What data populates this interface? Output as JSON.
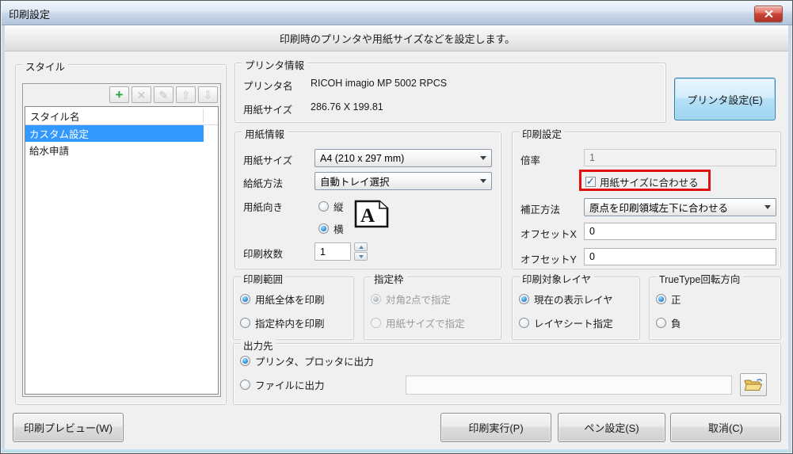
{
  "window": {
    "title": "印刷設定"
  },
  "header": {
    "subtitle": "印刷時のプリンタや用紙サイズなどを設定します。"
  },
  "style_panel": {
    "group_label": "スタイル",
    "list_header": "スタイル名",
    "items": [
      {
        "label": "カスタム設定"
      },
      {
        "label": "給水申請"
      }
    ]
  },
  "printer_info": {
    "group_label": "プリンタ情報",
    "name_label": "プリンタ名",
    "name_value": "RICOH imagio MP 5002 RPCS",
    "size_label": "用紙サイズ",
    "size_value": "286.76 X 199.81",
    "settings_button": "プリンタ設定(E)"
  },
  "paper_info": {
    "group_label": "用紙情報",
    "size_label": "用紙サイズ",
    "size_value": "A4 (210 x 297 mm)",
    "feed_label": "給紙方法",
    "feed_value": "自動トレイ選択",
    "orientation_label": "用紙向き",
    "portrait": "縦",
    "landscape": "横",
    "orientation_glyph": "A",
    "copies_label": "印刷枚数",
    "copies_value": "1"
  },
  "print_settings": {
    "group_label": "印刷設定",
    "scale_label": "倍率",
    "scale_value": "1",
    "fit_label": "用紙サイズに合わせる",
    "correction_label": "補正方法",
    "correction_value": "原点を印刷領域左下に合わせる",
    "offset_x_label": "オフセットX",
    "offset_x_value": "0",
    "offset_y_label": "オフセットY",
    "offset_y_value": "0"
  },
  "print_range": {
    "group_label": "印刷範囲",
    "whole_paper": "用紙全体を印刷",
    "inside_frame": "指定枠内を印刷"
  },
  "spec_frame": {
    "group_label": "指定枠",
    "two_points": "対角2点で指定",
    "by_paper_size": "用紙サイズで指定"
  },
  "target_layer": {
    "group_label": "印刷対象レイヤ",
    "current_layer": "現在の表示レイヤ",
    "layer_sheet": "レイヤシート指定"
  },
  "truetype": {
    "group_label": "TrueType回転方向",
    "positive": "正",
    "negative": "負"
  },
  "output": {
    "group_label": "出力先",
    "to_printer": "プリンタ、プロッタに出力",
    "to_file": "ファイルに出力",
    "file_path": ""
  },
  "buttons": {
    "preview": "印刷プレビュー(W)",
    "execute": "印刷実行(P)",
    "pen": "ペン設定(S)",
    "cancel": "取消(C)"
  },
  "colors": {
    "selection": "#3399ff",
    "highlight_box": "#e01010",
    "accent_button_border": "#2c7cb5"
  }
}
